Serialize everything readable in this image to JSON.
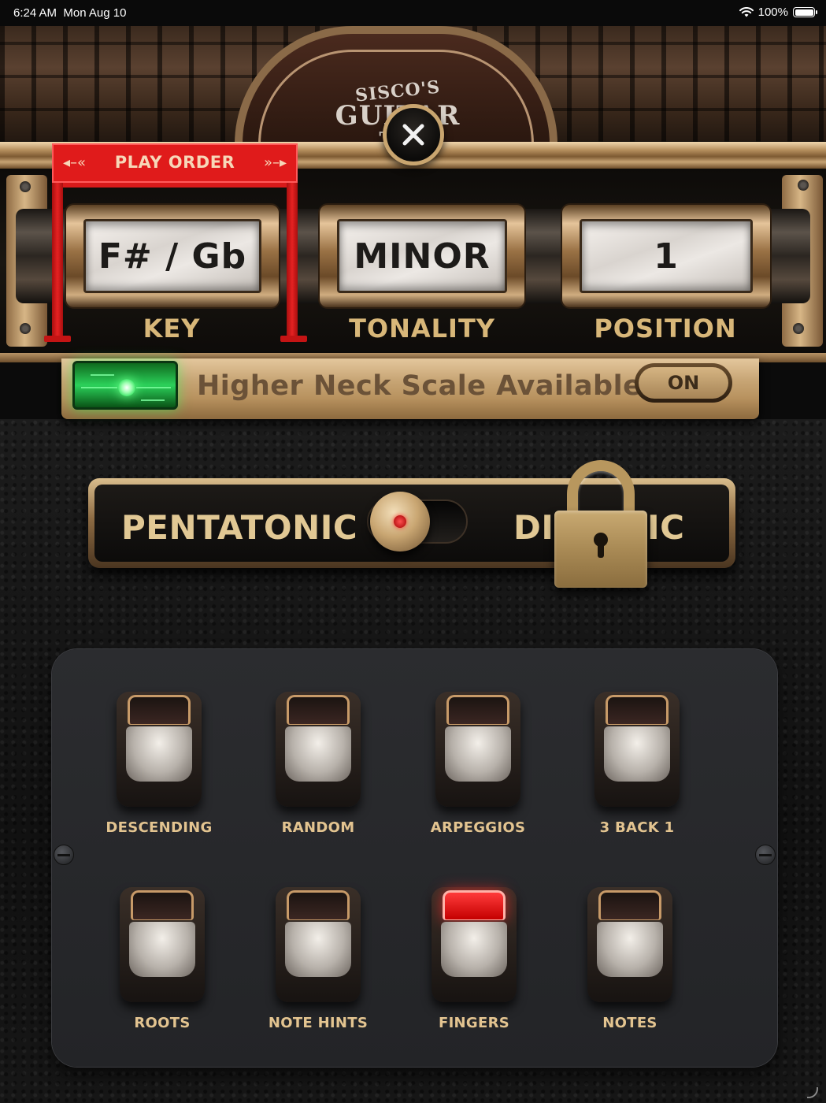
{
  "status_bar": {
    "time": "6:24 AM",
    "date": "Mon Aug 10",
    "battery": "100%",
    "wifi_icon": "wifi-icon",
    "battery_icon": "battery-icon"
  },
  "header": {
    "logo_line1": "SISCO'S",
    "logo_line2": "GUITAR",
    "logo_line3": "TR",
    "close_icon": "close-icon"
  },
  "play_order": {
    "label": "PLAY ORDER"
  },
  "tumblers": [
    {
      "value": "F# / Gb",
      "label": "KEY"
    },
    {
      "value": "MINOR",
      "label": "TONALITY"
    },
    {
      "value": "1",
      "label": "POSITION"
    }
  ],
  "higher_neck": {
    "label": "Higher Neck Scale Available",
    "toggle_label": "ON"
  },
  "scale_switch": {
    "left_label": "PENTATONIC",
    "right_label": "DIATONIC",
    "right_label_visible_left": "DI",
    "right_label_visible_right": "IC",
    "selected": "PENTATONIC",
    "locked": true
  },
  "buttons": [
    {
      "label": "DESCENDING",
      "lit": false
    },
    {
      "label": "RANDOM",
      "lit": false
    },
    {
      "label": "ARPEGGIOS",
      "lit": false
    },
    {
      "label": "3 BACK 1",
      "lit": false
    },
    {
      "label": "ROOTS",
      "lit": false
    },
    {
      "label": "NOTE HINTS",
      "lit": false
    },
    {
      "label": "FINGERS",
      "lit": true
    },
    {
      "label": "NOTES",
      "lit": false
    }
  ],
  "colors": {
    "accent_gold": "#d8b779",
    "play_order_red": "#e01b1b",
    "led_green": "#2bd15a",
    "lit_red": "#ff3b3b"
  }
}
